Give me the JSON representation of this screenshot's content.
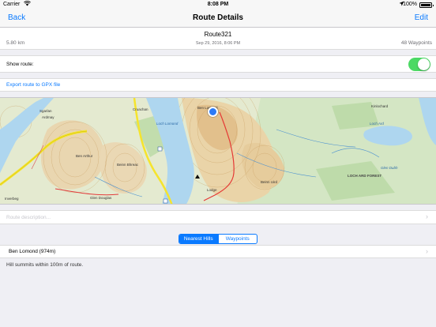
{
  "status_bar": {
    "carrier": "Carrier",
    "time": "8:08 PM",
    "battery": "100%",
    "icons": [
      "wifi-icon",
      "location-arrow-icon",
      "battery-icon"
    ]
  },
  "nav": {
    "back_label": "Back",
    "title": "Route Details",
    "edit_label": "Edit"
  },
  "route": {
    "name": "Route321",
    "date": "Sep 29, 2016, 8:06 PM",
    "distance": "5.80 km",
    "waypoints": "48 Waypoints"
  },
  "show_route": {
    "label": "Show route:",
    "enabled": true
  },
  "export": {
    "label": "Export route to GPX file"
  },
  "map": {
    "places": [
      "Sgarlan",
      "Ardmay",
      "Ben Arthur",
      "Ben Lomond",
      "Beinn Bhreac",
      "Glen Douglas",
      "Beinn Uird",
      "Loch Ard",
      "LOCH ARD FOREST",
      "Kinlochard",
      "Glen Dubh",
      "Cruachan",
      "Loch Lomond",
      "Inverbeg",
      "Lodge"
    ],
    "colors": {
      "route": "#e53935",
      "water": "#aed6ef",
      "location_dot": "#2b7af7"
    }
  },
  "description": {
    "placeholder": "Route description..."
  },
  "tabs": [
    {
      "label": "Nearest Hills",
      "active": true
    },
    {
      "label": "Waypoints",
      "active": false
    }
  ],
  "hills": [
    {
      "name": "Ben Lomond (974m)"
    }
  ],
  "note": "Hill summits within 100m of route.",
  "accent_color": "#0a7aff",
  "toggle_color": "#4cd964"
}
